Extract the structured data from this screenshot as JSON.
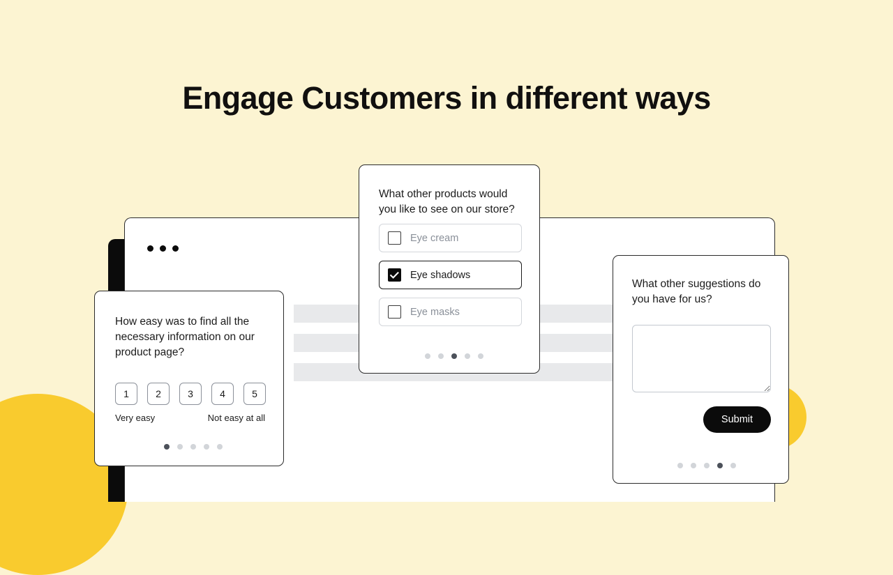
{
  "page": {
    "title": "Engage Customers in different ways",
    "background_color": "#FCF4D2",
    "accent_color": "#F9CB2E",
    "ink_color": "#0B0B0B"
  },
  "browser": {
    "traffic_lights": [
      "dot-1",
      "dot-2",
      "dot-3"
    ],
    "skeleton_bars": 3
  },
  "cards": {
    "rating": {
      "question": "How easy was to find all the necessary information on our product page?",
      "options": [
        "1",
        "2",
        "3",
        "4",
        "5"
      ],
      "label_low": "Very easy",
      "label_high": "Not easy at all",
      "pager": {
        "total": 5,
        "active": 1
      }
    },
    "choice": {
      "question": "What other products would you like to see on our store?",
      "options": [
        {
          "label": "Eye cream",
          "checked": false
        },
        {
          "label": "Eye shadows",
          "checked": true
        },
        {
          "label": "Eye masks",
          "checked": false
        }
      ],
      "pager": {
        "total": 5,
        "active": 3
      }
    },
    "text": {
      "question": "What other suggestions do you have for us?",
      "answer_value": "",
      "answer_placeholder": "",
      "submit_label": "Submit",
      "pager": {
        "total": 5,
        "active": 4
      }
    }
  }
}
